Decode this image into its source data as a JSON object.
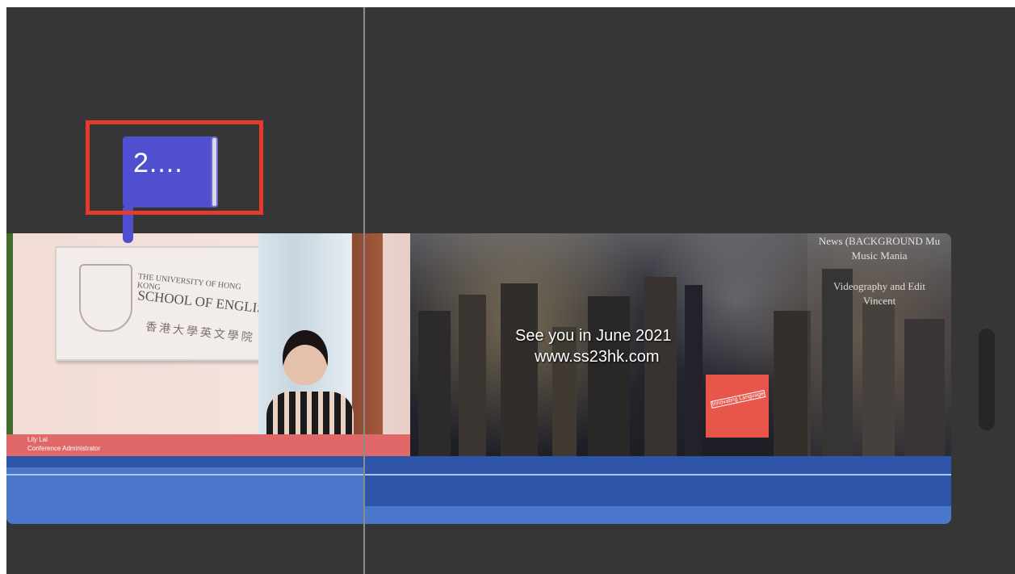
{
  "marker": {
    "label": "2...."
  },
  "video": {
    "office_clip": {
      "sign_line1": "THE UNIVERSITY OF HONG KONG",
      "sign_line2": "SCHOOL OF ENGLISH",
      "sign_line3": "香港大學英文學院",
      "lower_third_name": "Lily Lai",
      "lower_third_title": "Conference Administrator"
    },
    "city_clip": {
      "line1": "See you in June 2021",
      "line2": "www.ss23hk.com",
      "logo_text": "Innovating Language"
    },
    "credits_clip": {
      "line1": "News (BACKGROUND Mu",
      "line2": "Music Mania",
      "line3": "Videography and Edit",
      "line4": "Vincent"
    }
  },
  "colors": {
    "timeline_bg": "#363636",
    "marker": "#4f4fcf",
    "highlight": "#e63a2e",
    "audio": "#2f55a8"
  }
}
